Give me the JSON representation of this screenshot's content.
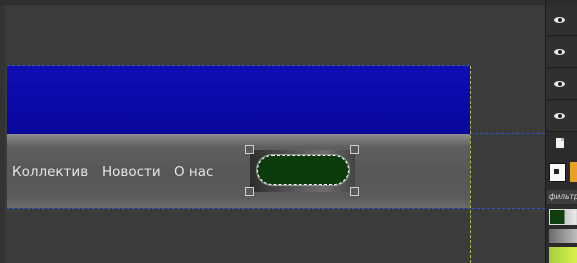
{
  "navigation": {
    "links": [
      "Коллектив",
      "Новости",
      "О нас"
    ]
  },
  "layers_panel": {
    "layer_count": 4,
    "effects_label": "фильтр"
  },
  "colors": {
    "banner": "#0a0aa8",
    "navbar": "#575757",
    "button_fill": "#0b3a0b",
    "guide_horizontal": "#2f54c8",
    "guide_vertical": "#b9b94a",
    "swatch_orange": "#e7a128",
    "swatch_green": "#a7cf3b"
  },
  "icons": {
    "layer_visibility": "eye-icon",
    "new_document": "document-icon"
  }
}
